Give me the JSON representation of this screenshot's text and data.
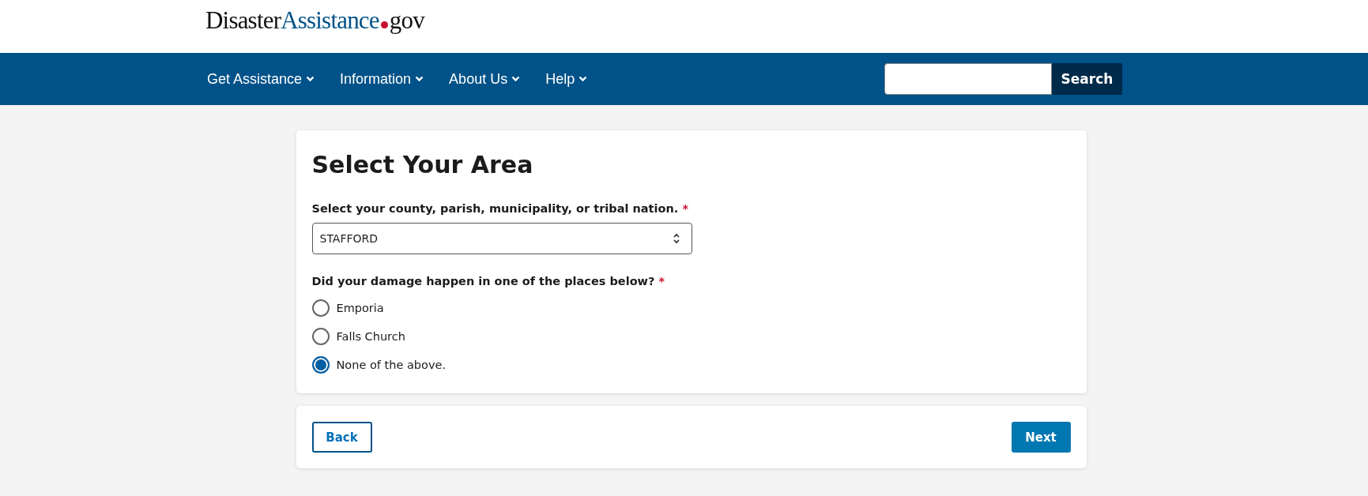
{
  "logo": {
    "primary": "Disaster",
    "secondary": "Assistance",
    "suffix": "gov"
  },
  "nav": [
    {
      "label": "Get Assistance"
    },
    {
      "label": "Information"
    },
    {
      "label": "About Us"
    },
    {
      "label": "Help"
    }
  ],
  "search": {
    "button": "Search"
  },
  "form": {
    "title": "Select Your Area",
    "area_label": "Select your county, parish, municipality, or tribal nation.",
    "required_mark": "*",
    "area_value": "STAFFORD",
    "places_label": "Did your damage happen in one of the places below?",
    "places_required_mark": "*",
    "options": [
      {
        "label": "Emporia",
        "selected": false
      },
      {
        "label": "Falls Church",
        "selected": false
      },
      {
        "label": "None of the above.",
        "selected": true
      }
    ]
  },
  "buttons": {
    "back": "Back",
    "next": "Next"
  }
}
